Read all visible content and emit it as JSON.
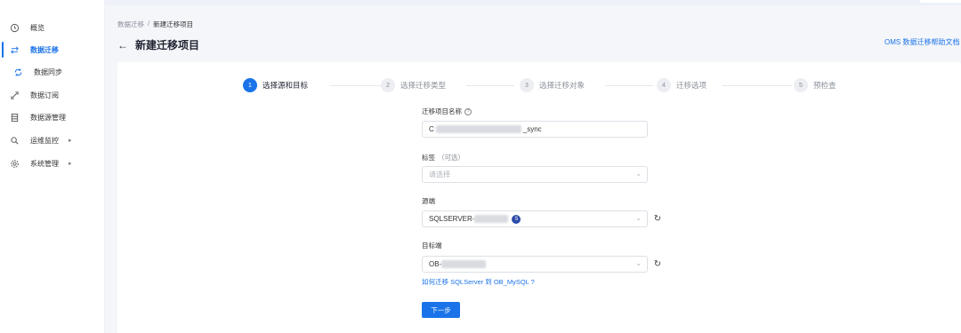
{
  "sidebar": {
    "items": [
      {
        "label": "概览",
        "icon": "dashboard-icon"
      },
      {
        "label": "数据迁移",
        "icon": "swap-icon",
        "active": true
      },
      {
        "label": "数据同步",
        "icon": "sync-icon"
      },
      {
        "label": "数据订阅",
        "icon": "subscribe-icon"
      },
      {
        "label": "数据源管理",
        "icon": "datasource-icon"
      },
      {
        "label": "运维监控",
        "icon": "monitor-icon",
        "expandable": true
      },
      {
        "label": "系统管理",
        "icon": "settings-icon",
        "expandable": true
      }
    ]
  },
  "header": {
    "breadcrumb_root": "数据迁移",
    "breadcrumb_sep": "/",
    "breadcrumb_current": "新建迁移项目",
    "back_icon": "←",
    "title": "新建迁移项目",
    "help_link": "OMS 数据迁移帮助文档"
  },
  "steps": [
    {
      "num": "1",
      "label": "选择源和目标",
      "active": true
    },
    {
      "num": "2",
      "label": "选择迁移类型"
    },
    {
      "num": "3",
      "label": "选择迁移对象"
    },
    {
      "num": "4",
      "label": "迁移选项"
    },
    {
      "num": "5",
      "label": "预检查"
    }
  ],
  "form": {
    "project_name_label": "迁移项目名称",
    "project_name_prefix": "C",
    "project_name_suffix": "_sync",
    "tags_label": "标签",
    "tags_optional": "（可选）",
    "tags_placeholder": "请选择",
    "source_label": "源端",
    "source_value": "SQLSERVER-",
    "source_badge": "S",
    "target_label": "目标端",
    "target_value": "OB-",
    "migrate_link": "如何迁移 SQLServer 到 OB_MySQL ?",
    "next_button": "下一步"
  },
  "colors": {
    "accent": "#1a73e8",
    "background": "#f4f6fa"
  }
}
